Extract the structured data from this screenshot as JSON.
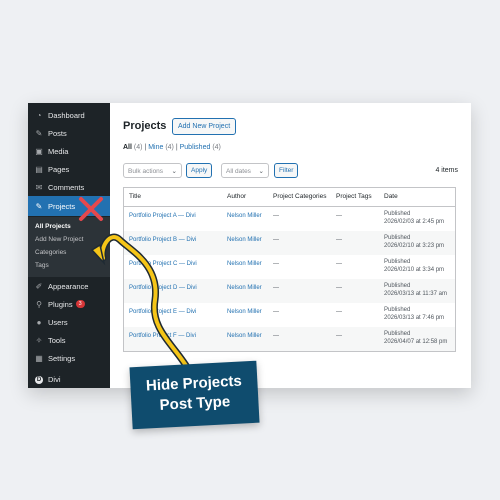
{
  "sidebar": {
    "items": [
      {
        "label": "Dashboard",
        "icon": "dashboard-icon"
      },
      {
        "label": "Posts",
        "icon": "pin-icon"
      },
      {
        "label": "Media",
        "icon": "media-icon"
      },
      {
        "label": "Pages",
        "icon": "pages-icon"
      },
      {
        "label": "Comments",
        "icon": "comment-icon"
      },
      {
        "label": "Projects",
        "icon": "pin-icon",
        "active": true
      },
      {
        "label": "Appearance",
        "icon": "brush-icon"
      },
      {
        "label": "Plugins",
        "icon": "plugin-icon",
        "badge": "3"
      },
      {
        "label": "Users",
        "icon": "user-icon"
      },
      {
        "label": "Tools",
        "icon": "wrench-icon"
      },
      {
        "label": "Settings",
        "icon": "settings-icon"
      },
      {
        "label": "Divi",
        "icon": "divi-icon"
      }
    ],
    "submenu": [
      "All Projects",
      "Add New Project",
      "Categories",
      "Tags"
    ]
  },
  "main": {
    "title": "Projects",
    "add_new": "Add New Project",
    "views": {
      "all": "All",
      "all_count": "(4)",
      "mine": "Mine",
      "mine_count": "(4)",
      "published": "Published",
      "published_count": "(4)"
    },
    "bulk_actions": "Bulk actions",
    "apply": "Apply",
    "all_dates": "All dates",
    "filter": "Filter",
    "items_count": "4 items",
    "columns": [
      "Title",
      "Author",
      "Project Categories",
      "Project Tags",
      "Date"
    ],
    "rows": [
      {
        "title": "Portfolio Project A — Divi",
        "author": "Nelson Miller",
        "categories": "—",
        "tags": "—",
        "status": "Published",
        "date": "2026/02/03 at 2:45 pm"
      },
      {
        "title": "Portfolio Project B — Divi",
        "author": "Nelson Miller",
        "categories": "—",
        "tags": "—",
        "status": "Published",
        "date": "2026/02/10 at 3:23 pm"
      },
      {
        "title": "Portfolio Project C — Divi",
        "author": "Nelson Miller",
        "categories": "—",
        "tags": "—",
        "status": "Published",
        "date": "2026/02/10 at 3:34 pm"
      },
      {
        "title": "Portfolio Project D — Divi",
        "author": "Nelson Miller",
        "categories": "—",
        "tags": "—",
        "status": "Published",
        "date": "2026/03/13 at 11:37 am"
      },
      {
        "title": "Portfolio Project E — Divi",
        "author": "Nelson Miller",
        "categories": "—",
        "tags": "—",
        "status": "Published",
        "date": "2026/03/13 at 7:46 pm"
      },
      {
        "title": "Portfolio Project F — Divi",
        "author": "Nelson Miller",
        "categories": "—",
        "tags": "—",
        "status": "Published",
        "date": "2026/04/07 at 12:58 pm"
      }
    ]
  },
  "callout": {
    "line1": "Hide Projects",
    "line2": "Post Type"
  },
  "colors": {
    "accent": "#2271b1",
    "sidebar": "#1d2327",
    "callout": "#0f4c6e",
    "arrow": "#f5c518",
    "xmark": "#e5484d"
  }
}
